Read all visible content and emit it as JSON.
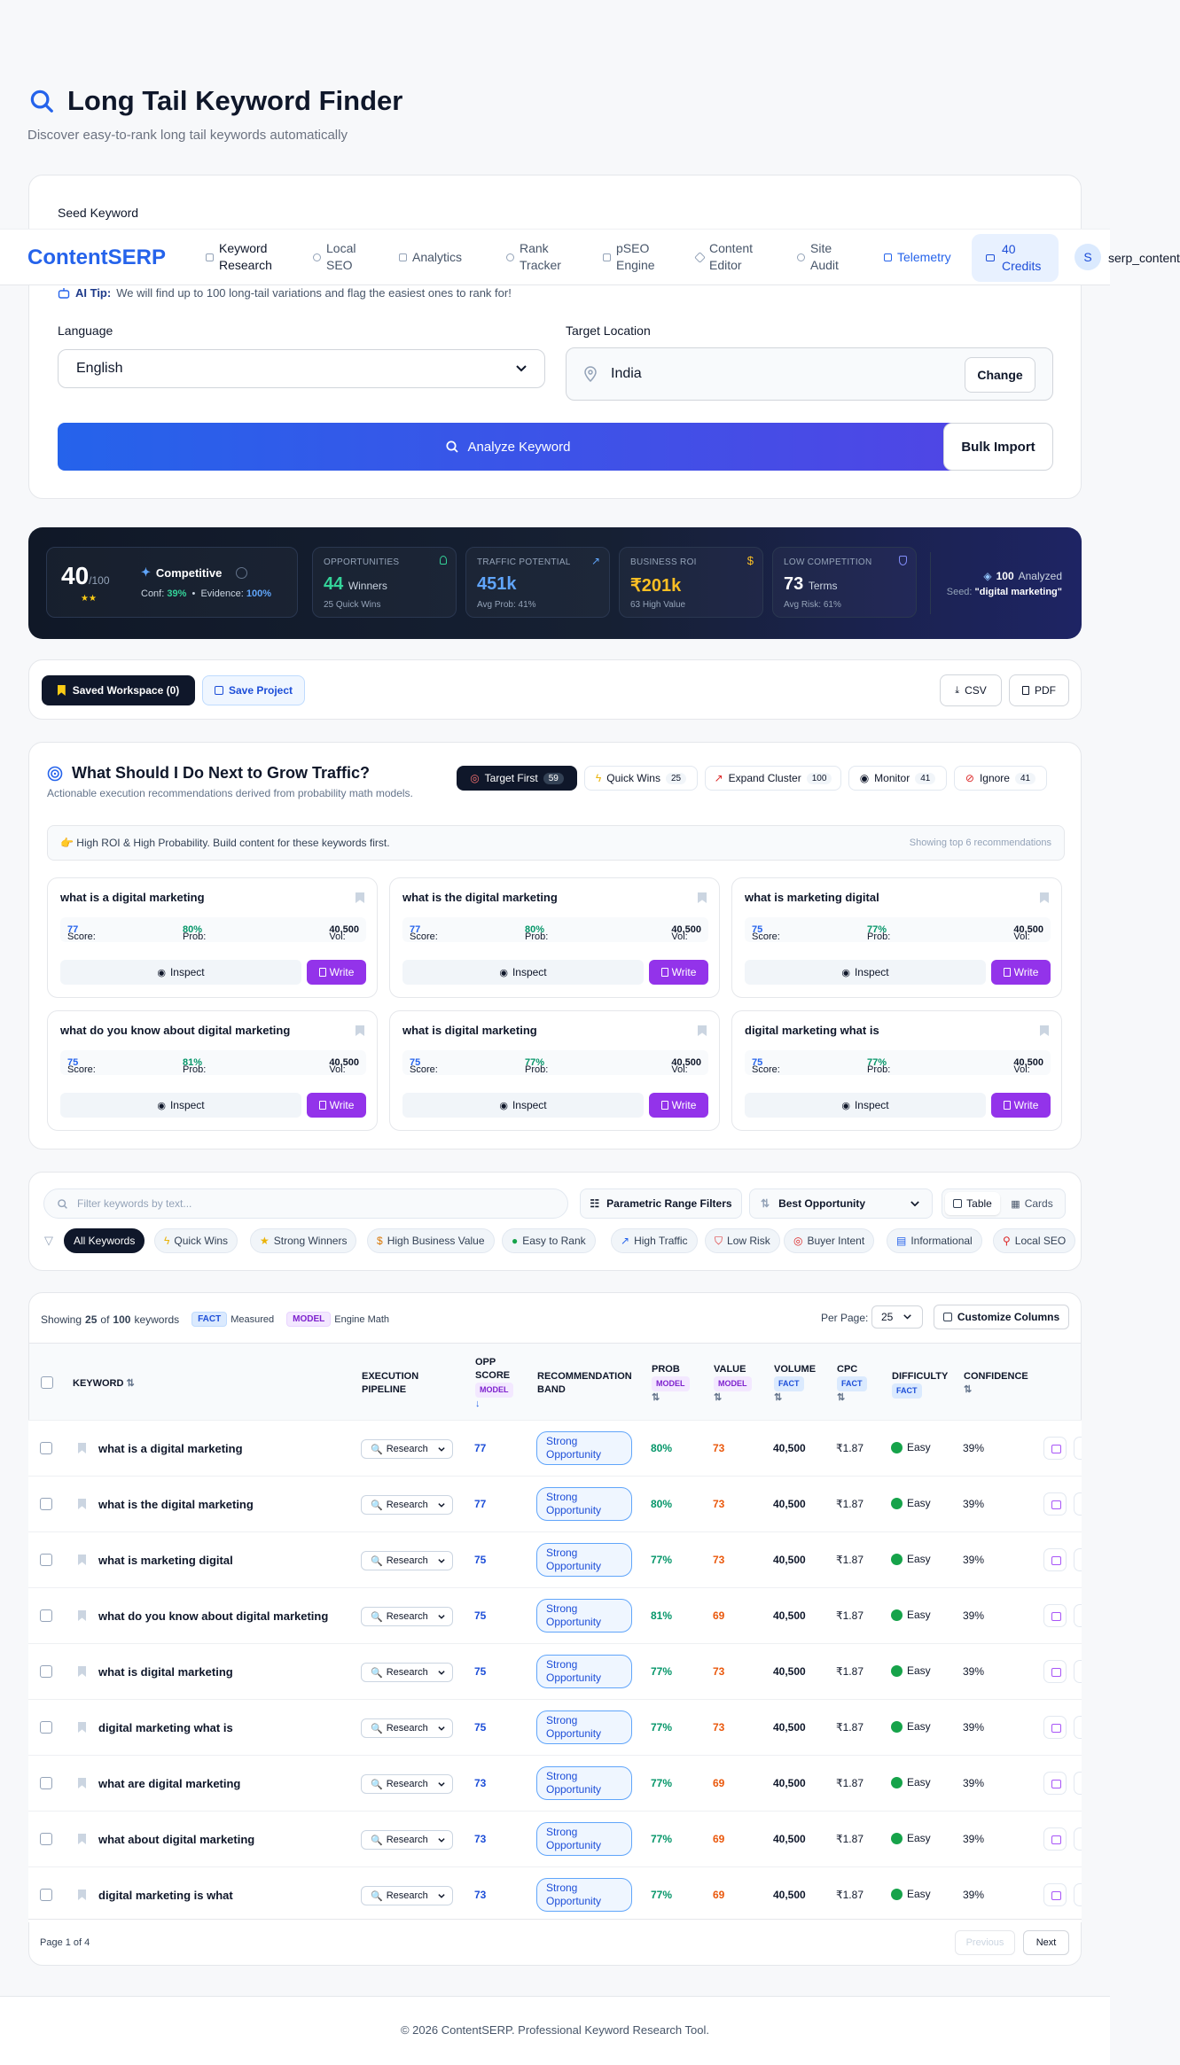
{
  "page": {
    "title": "Long Tail Keyword Finder",
    "subtitle": "Discover easy-to-rank long tail keywords automatically"
  },
  "nav": {
    "logo": "ContentSERP",
    "items": [
      {
        "label": "Keyword Research",
        "active": true
      },
      {
        "label": "Local SEO"
      },
      {
        "label": "Analytics"
      },
      {
        "label": "Rank Tracker"
      },
      {
        "label": "pSEO Engine"
      },
      {
        "label": "Content Editor"
      },
      {
        "label": "Site Audit"
      },
      {
        "label": "Telemetry"
      }
    ],
    "credits": "40 Credits",
    "avatar": "S",
    "username": "serp_content"
  },
  "form": {
    "seed_label": "Seed Keyword",
    "ai_tip_label": "AI Tip:",
    "ai_tip_text": "We will find up to 100 long-tail variations and flag the easiest ones to rank for!",
    "language_label": "Language",
    "language_value": "English",
    "location_label": "Target Location",
    "location_value": "India",
    "change_button": "Change",
    "analyze_button": "Analyze Keyword",
    "bulk_button": "Bulk Import"
  },
  "stats": {
    "score": "40",
    "score_max": "/100",
    "level": "Competitive",
    "conf_label": "Conf:",
    "conf_value": "39%",
    "evidence_label": "Evidence:",
    "evidence_value": "100%",
    "opportunities": {
      "label": "OPPORTUNITIES",
      "value": "44",
      "unit": "Winners",
      "sub": "25 Quick Wins"
    },
    "traffic": {
      "label": "TRAFFIC POTENTIAL",
      "value": "451k",
      "sub": "Avg Prob: 41%"
    },
    "roi": {
      "label": "BUSINESS ROI",
      "value": "₹201k",
      "sub": "63 High Value"
    },
    "low_comp": {
      "label": "LOW COMPETITION",
      "value": "73",
      "unit": "Terms",
      "sub": "Avg Risk: 61%"
    },
    "analyzed_count": "100",
    "analyzed_label": "Analyzed",
    "seed_label": "Seed:",
    "seed_value": "\"digital marketing\""
  },
  "workspace": {
    "saved_label": "Saved Workspace (0)",
    "save_project": "Save Project",
    "csv": "CSV",
    "pdf": "PDF"
  },
  "recommend": {
    "title": "What Should I Do Next to Grow Traffic?",
    "subtitle": "Actionable execution recommendations derived from probability math models.",
    "tabs": [
      {
        "label": "Target First",
        "count": "59"
      },
      {
        "label": "Quick Wins",
        "count": "25"
      },
      {
        "label": "Expand Cluster",
        "count": "100"
      },
      {
        "label": "Monitor",
        "count": "41"
      },
      {
        "label": "Ignore",
        "count": "41"
      }
    ],
    "banner": "High ROI & High Probability. Build content for these keywords first.",
    "banner_right": "Showing top 6 recommendations",
    "score_label": "Score:",
    "prob_label": "Prob:",
    "vol_label": "Vol:",
    "inspect": "Inspect",
    "write": "Write",
    "cards": [
      {
        "keyword": "what is a digital marketing",
        "score": "77",
        "prob": "80%",
        "vol": "40,500"
      },
      {
        "keyword": "what is the digital marketing",
        "score": "77",
        "prob": "80%",
        "vol": "40,500"
      },
      {
        "keyword": "what is marketing digital",
        "score": "75",
        "prob": "77%",
        "vol": "40,500"
      },
      {
        "keyword": "what do you know about digital marketing",
        "score": "75",
        "prob": "81%",
        "vol": "40,500"
      },
      {
        "keyword": "what is digital marketing",
        "score": "75",
        "prob": "77%",
        "vol": "40,500"
      },
      {
        "keyword": "digital marketing what is",
        "score": "75",
        "prob": "77%",
        "vol": "40,500"
      }
    ]
  },
  "filters": {
    "search_placeholder": "Filter keywords by text...",
    "range_filters": "Parametric Range Filters",
    "sort_value": "Best Opportunity",
    "view_table": "Table",
    "view_cards": "Cards",
    "chips": [
      "All Keywords",
      "Quick Wins",
      "Strong Winners",
      "High Business Value",
      "Easy to Rank",
      "High Traffic",
      "Low Risk",
      "Buyer Intent",
      "Informational",
      "Local SEO"
    ]
  },
  "table": {
    "showing_prefix": "Showing",
    "showing_count": "25",
    "showing_of": "of",
    "showing_total": "100",
    "showing_suffix": "keywords",
    "fact_badge": "FACT",
    "fact_text": "Measured",
    "model_badge": "MODEL",
    "model_text": "Engine Math",
    "per_page_label": "Per Page:",
    "per_page_value": "25",
    "customize": "Customize Columns",
    "headers": {
      "keyword": "KEYWORD",
      "pipeline": "EXECUTION PIPELINE",
      "opp": "OPP SCORE",
      "band": "RECOMMENDATION BAND",
      "prob": "PROB",
      "value": "VALUE",
      "volume": "VOLUME",
      "cpc": "CPC",
      "difficulty": "DIFFICULTY",
      "confidence": "CONFIDENCE"
    },
    "pipeline_value": "Research",
    "band_value": "Strong Opportunity",
    "rows": [
      {
        "keyword": "what is a digital marketing",
        "opp": "77",
        "prob": "80%",
        "value": "73",
        "volume": "40,500",
        "cpc": "₹1.87",
        "difficulty": "Easy",
        "confidence": "39%"
      },
      {
        "keyword": "what is the digital marketing",
        "opp": "77",
        "prob": "80%",
        "value": "73",
        "volume": "40,500",
        "cpc": "₹1.87",
        "difficulty": "Easy",
        "confidence": "39%"
      },
      {
        "keyword": "what is marketing digital",
        "opp": "75",
        "prob": "77%",
        "value": "73",
        "volume": "40,500",
        "cpc": "₹1.87",
        "difficulty": "Easy",
        "confidence": "39%"
      },
      {
        "keyword": "what do you know about digital marketing",
        "opp": "75",
        "prob": "81%",
        "value": "69",
        "volume": "40,500",
        "cpc": "₹1.87",
        "difficulty": "Easy",
        "confidence": "39%"
      },
      {
        "keyword": "what is digital marketing",
        "opp": "75",
        "prob": "77%",
        "value": "73",
        "volume": "40,500",
        "cpc": "₹1.87",
        "difficulty": "Easy",
        "confidence": "39%"
      },
      {
        "keyword": "digital marketing what is",
        "opp": "75",
        "prob": "77%",
        "value": "73",
        "volume": "40,500",
        "cpc": "₹1.87",
        "difficulty": "Easy",
        "confidence": "39%"
      },
      {
        "keyword": "what are digital marketing",
        "opp": "73",
        "prob": "77%",
        "value": "69",
        "volume": "40,500",
        "cpc": "₹1.87",
        "difficulty": "Easy",
        "confidence": "39%"
      },
      {
        "keyword": "what about digital marketing",
        "opp": "73",
        "prob": "77%",
        "value": "69",
        "volume": "40,500",
        "cpc": "₹1.87",
        "difficulty": "Easy",
        "confidence": "39%"
      },
      {
        "keyword": "digital marketing is what",
        "opp": "73",
        "prob": "77%",
        "value": "69",
        "volume": "40,500",
        "cpc": "₹1.87",
        "difficulty": "Easy",
        "confidence": "39%"
      }
    ],
    "page_info": "Page 1 of 4",
    "previous": "Previous",
    "next": "Next"
  },
  "footer": "© 2026 ContentSERP. Professional Keyword Research Tool.",
  "colors": {
    "accent": "#2563eb",
    "purple": "#9333ea",
    "dark": "#0f172a",
    "green": "#059669",
    "orange": "#ea580c"
  }
}
